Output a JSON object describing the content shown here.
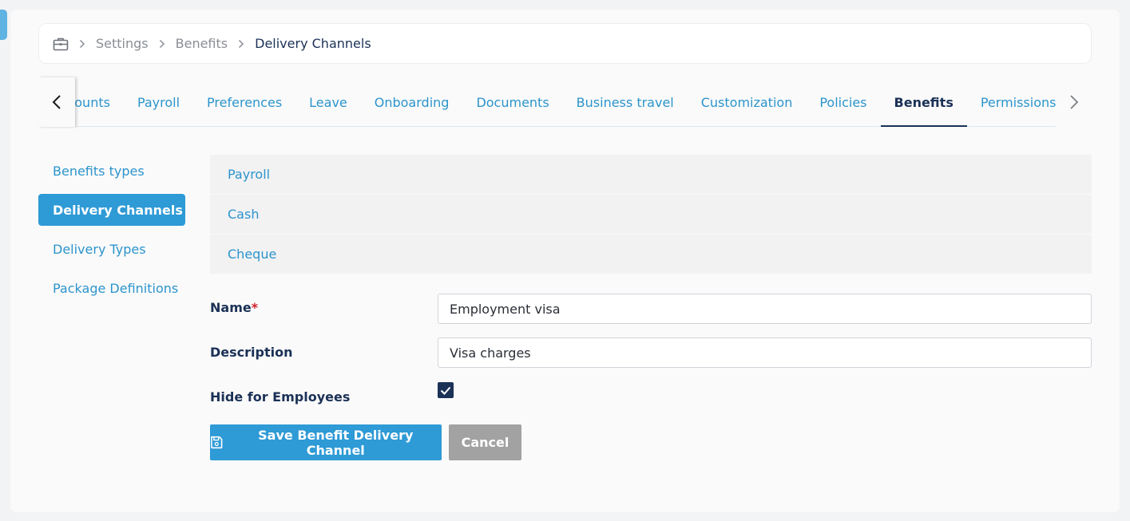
{
  "breadcrumb": {
    "icon": "briefcase-icon",
    "items": [
      "Settings",
      "Benefits",
      "Delivery Channels"
    ]
  },
  "tabs": [
    "Accounts",
    "Payroll",
    "Preferences",
    "Leave",
    "Onboarding",
    "Documents",
    "Business travel",
    "Customization",
    "Policies",
    "Benefits",
    "Permissions"
  ],
  "active_tab": "Benefits",
  "sidebar": {
    "items": [
      "Benefits types",
      "Delivery Channels",
      "Delivery Types",
      "Package Definitions"
    ],
    "active": "Delivery Channels"
  },
  "channels": [
    "Payroll",
    "Cash",
    "Cheque"
  ],
  "form": {
    "name_label": "Name",
    "required_mark": "*",
    "name_value": "Employment visa",
    "description_label": "Description",
    "description_value": "Visa charges",
    "hide_label": "Hide for Employees",
    "hide_checked": true
  },
  "buttons": {
    "save_label": "Save Benefit Delivery Channel",
    "cancel_label": "Cancel"
  },
  "colors": {
    "accent": "#2e9ad6",
    "link": "#2c94cc",
    "navy": "#1b3156",
    "cancel": "#a2a2a2"
  }
}
